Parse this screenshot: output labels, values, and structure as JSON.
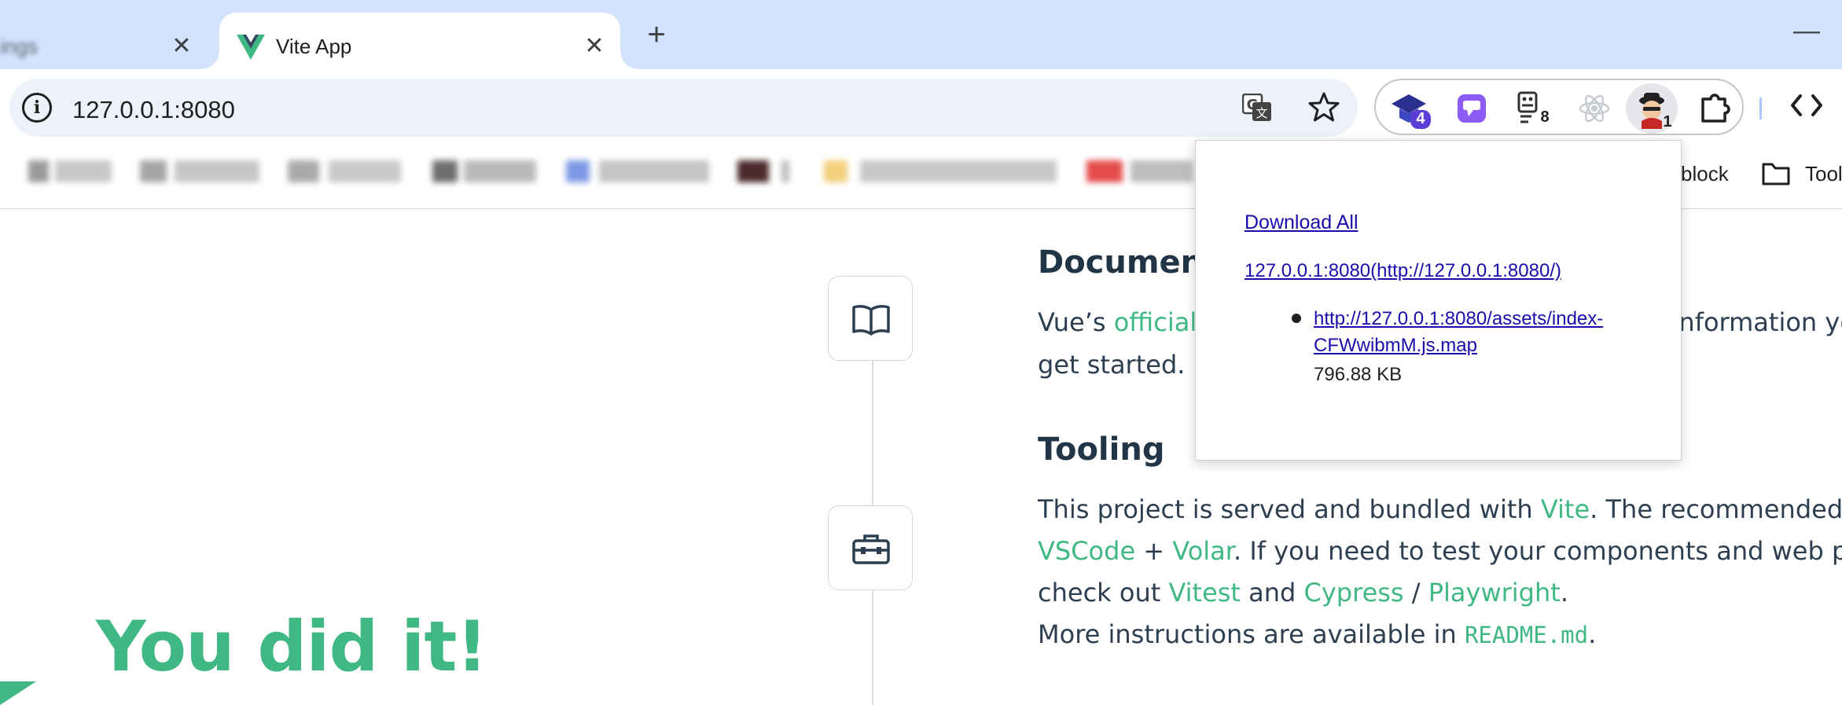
{
  "tabs": {
    "inactive_title": "ings",
    "active_title": "Vite App",
    "close_glyph": "✕",
    "new_tab_glyph": "+",
    "minimize_glyph": "—"
  },
  "toolbar": {
    "site_info_glyph": "i",
    "url": "127.0.0.1:8080",
    "extensions": {
      "first_badge": "4",
      "third_badge": "8",
      "fifth_badge": "1"
    }
  },
  "bookmarks": {
    "visible_item_1": "block",
    "visible_item_2": "Tool"
  },
  "page": {
    "documentation_heading": "Documentation",
    "documentation_line1_prefix": "Vue’s ",
    "documentation_line1_link": "official documentation",
    "documentation_line1_suffix": " provides you with all information you need to",
    "documentation_line2": "get started.",
    "tooling_heading": "Tooling",
    "tooling_line1_prefix": "This project is served and bundled with ",
    "tooling_vite": "Vite",
    "tooling_line1_suffix": ". The recommended IDE setup is",
    "tooling_vscode": "VSCode",
    "tooling_plus": " + ",
    "tooling_volar": "Volar",
    "tooling_line2_suffix": ". If you need to test your components and web pages,",
    "tooling_line3_prefix": "check out ",
    "tooling_vitest": "Vitest",
    "tooling_and": " and ",
    "tooling_cypress": "Cypress",
    "tooling_slash": " / ",
    "tooling_playwright": "Playwright",
    "tooling_period": ".",
    "tooling_line4_prefix": "More instructions are available in ",
    "tooling_readme": "README.md",
    "tooling_line4_suffix": ".",
    "hero_title": "You did it!"
  },
  "popup": {
    "download_all": "Download All",
    "origin_link": "127.0.0.1:8080(http://127.0.0.1:8080/)",
    "files": [
      {
        "url": "http://127.0.0.1:8080/assets/index-CFWwibmM.js.map",
        "size": "796.88 KB"
      }
    ]
  },
  "colors": {
    "tabstrip": "#d3e3fd",
    "omnibox": "#edf2fa",
    "vue_green": "#40b883",
    "link_blue": "#1a0dab",
    "heading": "#213547"
  },
  "icons": [
    "vue-logo-icon",
    "close-icon",
    "plus-icon",
    "minimize-icon",
    "info-icon",
    "translate-icon",
    "star-icon",
    "puzzle-icon",
    "devtools-code-icon",
    "folder-icon",
    "book-icon",
    "toolbox-icon"
  ]
}
